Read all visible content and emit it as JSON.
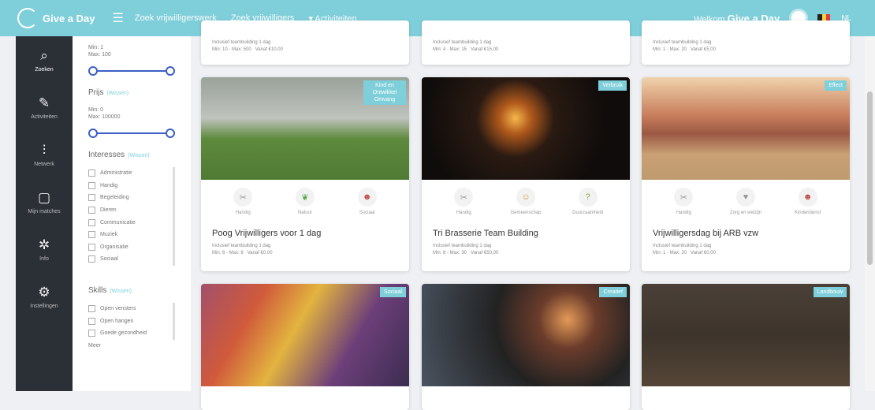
{
  "brand": {
    "name": "Give a Day"
  },
  "topnav": [
    "Zoek vrijwilligerswerk",
    "Zoek vrijwilligers",
    "Activiteiten"
  ],
  "user": {
    "welcome": "Welkom",
    "name": "Give a Day",
    "lang": "NL"
  },
  "leftnav": [
    {
      "label": "Zoeken",
      "icon": "search-icon"
    },
    {
      "label": "Activiteiten",
      "icon": "tools-icon"
    },
    {
      "label": "Netwerk",
      "icon": "sliders-icon"
    },
    {
      "label": "Mijn matches",
      "icon": "bookmark-icon"
    },
    {
      "label": "Info",
      "icon": "settings-icon"
    },
    {
      "label": "Instellingen",
      "icon": "gear-icon"
    }
  ],
  "filters": {
    "age": {
      "min": "Min: 1",
      "max": "Max: 100",
      "range": [
        0,
        1
      ]
    },
    "price": {
      "title": "Prijs",
      "clear": "(Wissen)",
      "min": "Min: 0",
      "max": "Max: 100000",
      "range": [
        0,
        1
      ]
    },
    "interests": {
      "title": "Interesses",
      "clear": "(Wissen)",
      "items": [
        "Administratie",
        "Handig",
        "Begeleiding",
        "Dieren",
        "Communicatie",
        "Muziek",
        "Organisatie",
        "Sociaal"
      ]
    },
    "skills": {
      "title": "Skills",
      "clear": "(Wissen)",
      "items": [
        "Open vensters",
        "Open hangen",
        "Goede gezondheid"
      ],
      "more": "Meer"
    }
  },
  "top_stubs": [
    {
      "line1": "Inclusief teambuilding 1 dag",
      "line2": "Min: 10 - Max: 500",
      "line3": "Vanaf €10,00"
    },
    {
      "line1": "Inclusief teambuilding 1 dag",
      "line2": "Min: 4 - Max: 15",
      "line3": "Vanaf €15,00"
    },
    {
      "line1": "Inclusief teambuilding 1 dag",
      "line2": "Min: 1 - Max: 20",
      "line3": "Vanaf €5,00"
    }
  ],
  "cards": [
    {
      "badge": "Kind en Ontwikkel Omvang",
      "title": "Poog Vrijwilligers voor 1 dag",
      "icons": [
        "Handig",
        "Natuur",
        "Sociaal"
      ],
      "line1": "Inclusief teambuilding 1 dag",
      "line2": "Min: 6 - Max: 6",
      "line3": "Vanaf €0,00"
    },
    {
      "badge": "Verbruik",
      "title": "Tri Brasserie Team Building",
      "icons": [
        "Handig",
        "Gemeenschap",
        "Duurzaamheid"
      ],
      "line1": "Inclusief teambuilding 1 dag",
      "line2": "Min: 8 - Max: 30",
      "line3": "Vanaf €50,00"
    },
    {
      "badge": "Effect",
      "title": "Vrijwilligersdag bij ARB vzw",
      "icons": [
        "Handig",
        "Zorg en welzijn",
        "Kinderdienst"
      ],
      "line1": "Inclusief teambuilding 1 dag",
      "line2": "Min: 1 - Max: 20",
      "line3": "Vanaf €0,00"
    },
    {
      "badge": "Sociaal",
      "title": "",
      "icons": [],
      "line1": "",
      "line2": "",
      "line3": ""
    },
    {
      "badge": "Creatief",
      "title": "",
      "icons": [],
      "line1": "",
      "line2": "",
      "line3": ""
    },
    {
      "badge": "Landbouw",
      "title": "",
      "icons": [],
      "line1": "",
      "line2": "",
      "line3": ""
    }
  ],
  "colors": {
    "accent": "#7fcfdb",
    "sidebar": "#2b2f36",
    "slider": "#3b5fc7"
  }
}
